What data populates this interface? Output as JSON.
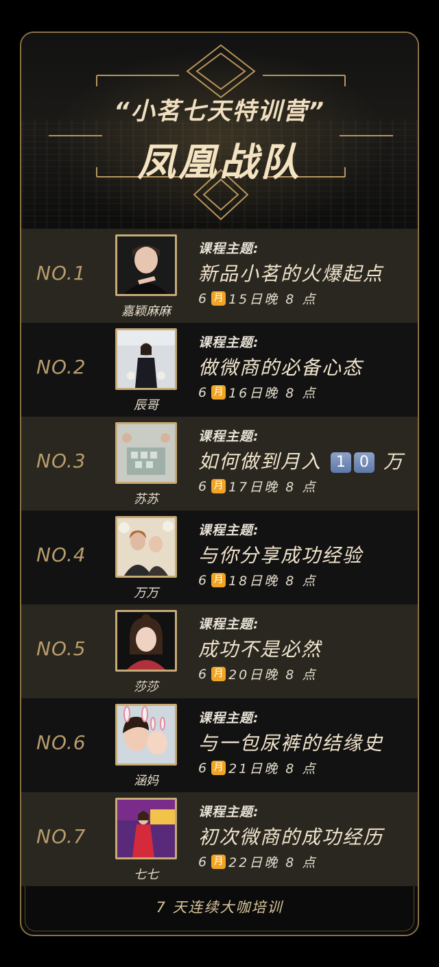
{
  "header": {
    "title_line1": "“小茗七天特训营”",
    "title_line2": "凤凰战队"
  },
  "schedule": [
    {
      "no": "NO.1",
      "name": "嘉颖麻麻",
      "topic_label": "课程主题:",
      "topic": "新品小茗的火爆起点",
      "date_prefix": "6",
      "month": "月",
      "date_suffix": "15日晚 8 点"
    },
    {
      "no": "NO.2",
      "name": "辰哥",
      "topic_label": "课程主题:",
      "topic": "做微商的必备心态",
      "date_prefix": "6",
      "month": "月",
      "date_suffix": "16日晚 8 点"
    },
    {
      "no": "NO.3",
      "name": "苏苏",
      "topic_label": "课程主题:",
      "topic_a": "如何做到月入",
      "topic_d1": "1",
      "topic_d2": "0",
      "topic_b": "万",
      "date_prefix": "6",
      "month": "月",
      "date_suffix": "17日晚 8 点"
    },
    {
      "no": "NO.4",
      "name": "万万",
      "topic_label": "课程主题:",
      "topic": "与你分享成功经验",
      "date_prefix": "6",
      "month": "月",
      "date_suffix": "18日晚 8 点"
    },
    {
      "no": "NO.5",
      "name": "莎莎",
      "topic_label": "课程主题:",
      "topic": "成功不是必然",
      "date_prefix": "6",
      "month": "月",
      "date_suffix": "20日晚 8 点"
    },
    {
      "no": "NO.6",
      "name": "涵妈",
      "topic_label": "课程主题:",
      "topic": "与一包尿裤的结缘史",
      "date_prefix": "6",
      "month": "月",
      "date_suffix": "21日晚 8 点"
    },
    {
      "no": "NO.7",
      "name": "七七",
      "topic_label": "课程主题:",
      "topic": "初次微商的成功经历",
      "date_prefix": "6",
      "month": "月",
      "date_suffix": "22日晚 8 点"
    }
  ],
  "footer": {
    "text": "7 天连续大咖培训"
  },
  "colors": {
    "gold": "#c8ab75",
    "month_badge": "#f0a524",
    "row_light": "#2a2720",
    "row_dark": "#121212"
  }
}
